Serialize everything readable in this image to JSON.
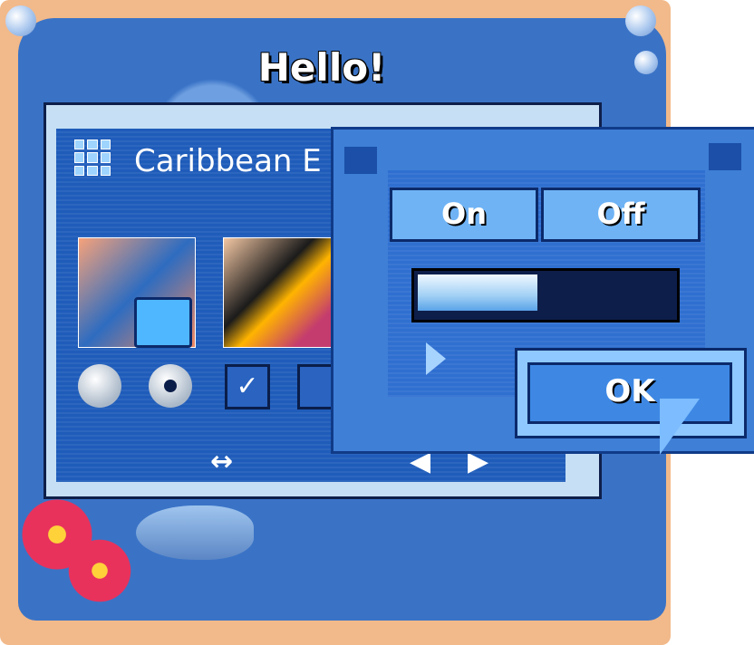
{
  "window": {
    "title": "Hello!"
  },
  "main": {
    "app_title": "Caribbean E",
    "scroll_arrows": {
      "horizontal": "↔",
      "left": "◀",
      "right": "▶"
    },
    "controls": {
      "check_glyph": "✓"
    }
  },
  "dialog": {
    "toggle": {
      "on_label": "On",
      "off_label": "Off"
    },
    "progress_fraction": 0.48,
    "ok_label": "OK"
  },
  "icons": [
    "grid-icon",
    "finder-icon",
    "play-icon",
    "cursor-icon",
    "flower-icon",
    "fish-icon"
  ],
  "colors": {
    "accent": "#3f7fd6",
    "dark_border": "#0b2a6b",
    "sand": "#f2b98a"
  }
}
